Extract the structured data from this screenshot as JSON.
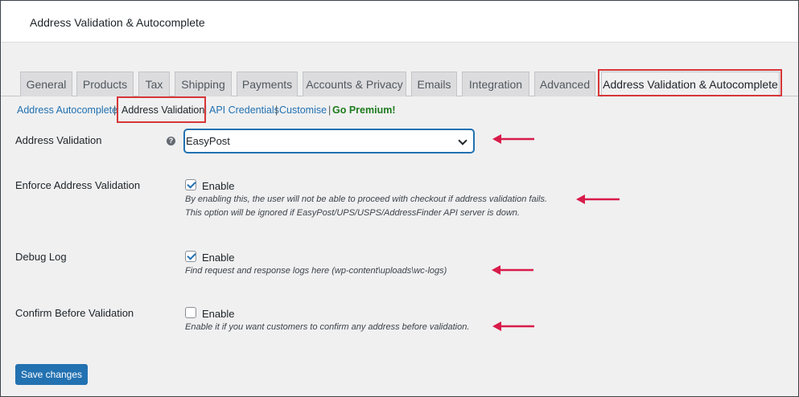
{
  "header": {
    "title": "Address Validation & Autocomplete"
  },
  "tabs": [
    {
      "label": "General"
    },
    {
      "label": "Products"
    },
    {
      "label": "Tax"
    },
    {
      "label": "Shipping"
    },
    {
      "label": "Payments"
    },
    {
      "label": "Accounts & Privacy"
    },
    {
      "label": "Emails"
    },
    {
      "label": "Integration"
    },
    {
      "label": "Advanced"
    },
    {
      "label": "Address Validation & Autocomplete"
    }
  ],
  "subnav": {
    "autocomplete": "Address Autocomplete",
    "validation": "Address Validation",
    "api": "API Credentials",
    "customise": "Customise",
    "premium": "Go Premium!",
    "separator": "|"
  },
  "fields": {
    "validation": {
      "label": "Address Validation",
      "value": "EasyPost"
    },
    "enforce": {
      "label": "Enforce Address Validation",
      "checkbox_label": "Enable",
      "checked": true,
      "desc1": "By enabling this, the user will not be able to proceed with checkout if address validation fails.",
      "desc2": "This option will be ignored if EasyPost/UPS/USPS/AddressFinder API server is down."
    },
    "debug": {
      "label": "Debug Log",
      "checkbox_label": "Enable",
      "checked": true,
      "desc": "Find request and response logs here (wp-content\\uploads\\wc-logs)"
    },
    "confirm": {
      "label": "Confirm Before Validation",
      "checkbox_label": "Enable",
      "checked": false,
      "desc": "Enable it if you want customers to confirm any address before validation."
    }
  },
  "save_label": "Save changes",
  "colors": {
    "accent": "#2271b1",
    "highlight": "#d63638",
    "arrow": "#d81b4a",
    "premium": "#1e7b1e"
  }
}
